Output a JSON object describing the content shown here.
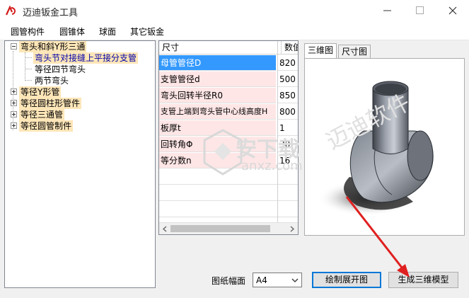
{
  "window": {
    "title": "迈迪钣金工具",
    "buttons": [
      "minimize",
      "maximize",
      "close"
    ]
  },
  "menu": {
    "items": [
      "圆管构件",
      "圆锥体",
      "球面",
      "其它钣金"
    ]
  },
  "tree": {
    "root": "弯头和斜Y形三通",
    "children": [
      "弯头节对接缝上平接分支管",
      "等径四节弯头",
      "两节弯头"
    ],
    "collapsed": [
      "等径Y形管",
      "等径圆柱形管件",
      "等径三通管",
      "等径圆管制件"
    ]
  },
  "grid": {
    "headers": [
      "尺寸",
      "数值"
    ],
    "rows": [
      {
        "label": "母管管径D",
        "value": "820"
      },
      {
        "label": "支管管径d",
        "value": "500"
      },
      {
        "label": "弯头回转半径R0",
        "value": "850"
      },
      {
        "label": "支管上端到弯头管中心线高度H",
        "value": "800"
      },
      {
        "label": "板厚t",
        "value": "1"
      },
      {
        "label": "回转角Φ",
        "value": "30"
      },
      {
        "label": "等分数n",
        "value": "16"
      }
    ]
  },
  "tabs": [
    "三维图",
    "尺寸图"
  ],
  "bottom": {
    "paper_label": "图纸幅面",
    "paper_value": "A4",
    "draw_button": "绘制展开图",
    "generate_button": "生成三维模型"
  },
  "watermarks": {
    "main": "安下载",
    "url": "anxz.com",
    "brand": "迈迪软件"
  },
  "colors": {
    "selection": "#3399ff",
    "label_cell": "#ffe6e6",
    "tree_highlight": "#fde6b8",
    "arrow": "#e02020"
  }
}
